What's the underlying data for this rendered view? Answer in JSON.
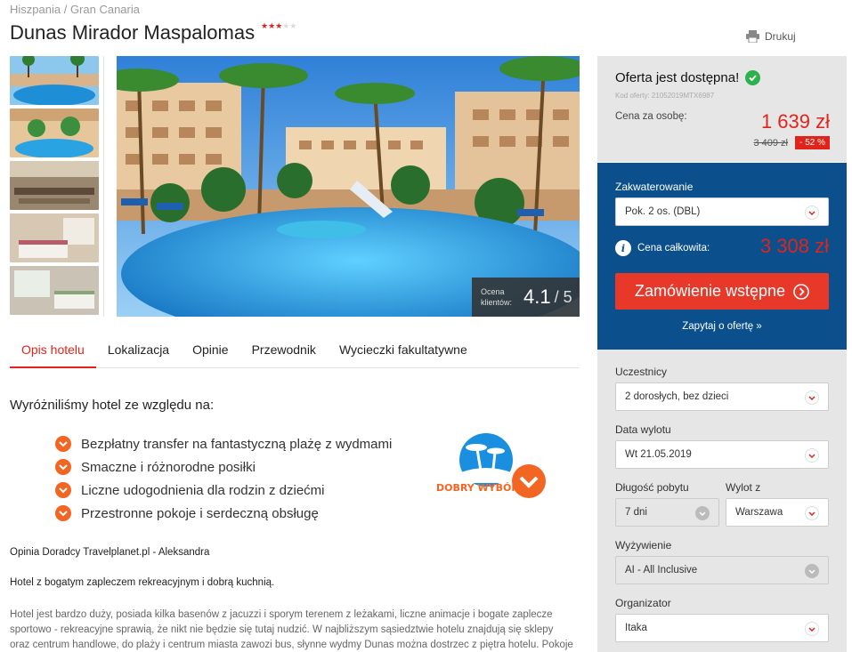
{
  "breadcrumb": {
    "country": "Hiszpania",
    "sep": " / ",
    "region": "Gran Canaria"
  },
  "hotel": {
    "name": "Dunas Mirador Maspalomas",
    "stars": 3,
    "stars_max": 5
  },
  "print_label": "Drukuj",
  "rating": {
    "label": "Ocena klientów:",
    "value": "4.1",
    "max": "/ 5"
  },
  "tabs": [
    {
      "label": "Opis hotelu",
      "active": true
    },
    {
      "label": "Lokalizacja",
      "active": false
    },
    {
      "label": "Opinie",
      "active": false
    },
    {
      "label": "Przewodnik",
      "active": false
    },
    {
      "label": "Wycieczki fakultatywne",
      "active": false
    }
  ],
  "why": {
    "title": "Wyróżniliśmy hotel ze względu na:",
    "features": [
      "Bezpłatny transfer na fantastyczną plażę z wydmami",
      "Smaczne i różnorodne posiłki",
      "Liczne udogodnienia dla rodzin z dziećmi",
      "Przestronne pokoje i serdeczną obsługę"
    ],
    "badge_text": "DOBRY WYBÓR"
  },
  "advisor": {
    "byline": "Opinia Doradcy Travelplanet.pl - Aleksandra",
    "headline": "Hotel z bogatym zapleczem rekreacyjnym i dobrą kuchnią.",
    "text": "Hotel jest bardzo duży, posiada kilka basenów z jacuzzi i sporym terenem z leżakami, liczne animacje i bogate zaplecze sportowo - rekreacyjne sprawią, że nikt nie będzie się tutaj nudzić. W najbliższym sąsiedztwie hotelu znajdują się sklepy oraz centrum handlowe, do plaży i centrum miasta zawozi bus, słynne wydmy Dunas można dostrzec z piętra hotelu. Pokoje wychodzą na ulice"
  },
  "offer": {
    "status": "Oferta jest dostępna!",
    "code": "Kod oferty: 21052019MTX6987",
    "price_label": "Cena za osobę:",
    "price": "1 639 zł",
    "old_price": "3 409 zł",
    "discount": "- 52 %"
  },
  "booking": {
    "accommodation_label": "Zakwaterowanie",
    "accommodation_value": "Pok. 2 os. (DBL)",
    "total_label": "Cena całkowita:",
    "total_price": "3 308 zł",
    "order_button": "Zamówienie wstępne",
    "ask_link": "Zapytaj o ofertę »"
  },
  "filters": {
    "participants_label": "Uczestnicy",
    "participants_value": "2 dorosłych, bez dzieci",
    "date_label": "Data wylotu",
    "date_value": "Wt 21.05.2019",
    "length_label": "Długość pobytu",
    "length_value": "7 dni",
    "departure_label": "Wylot z",
    "departure_value": "Warszawa",
    "board_label": "Wyżywienie",
    "board_value": "AI - All Inclusive",
    "organizer_label": "Organizator",
    "organizer_value": "Itaka"
  },
  "colors": {
    "accent_red": "#e2231a",
    "brand_blue": "#0b4f8c",
    "orange": "#f26522",
    "success_green": "#2bb24c"
  }
}
